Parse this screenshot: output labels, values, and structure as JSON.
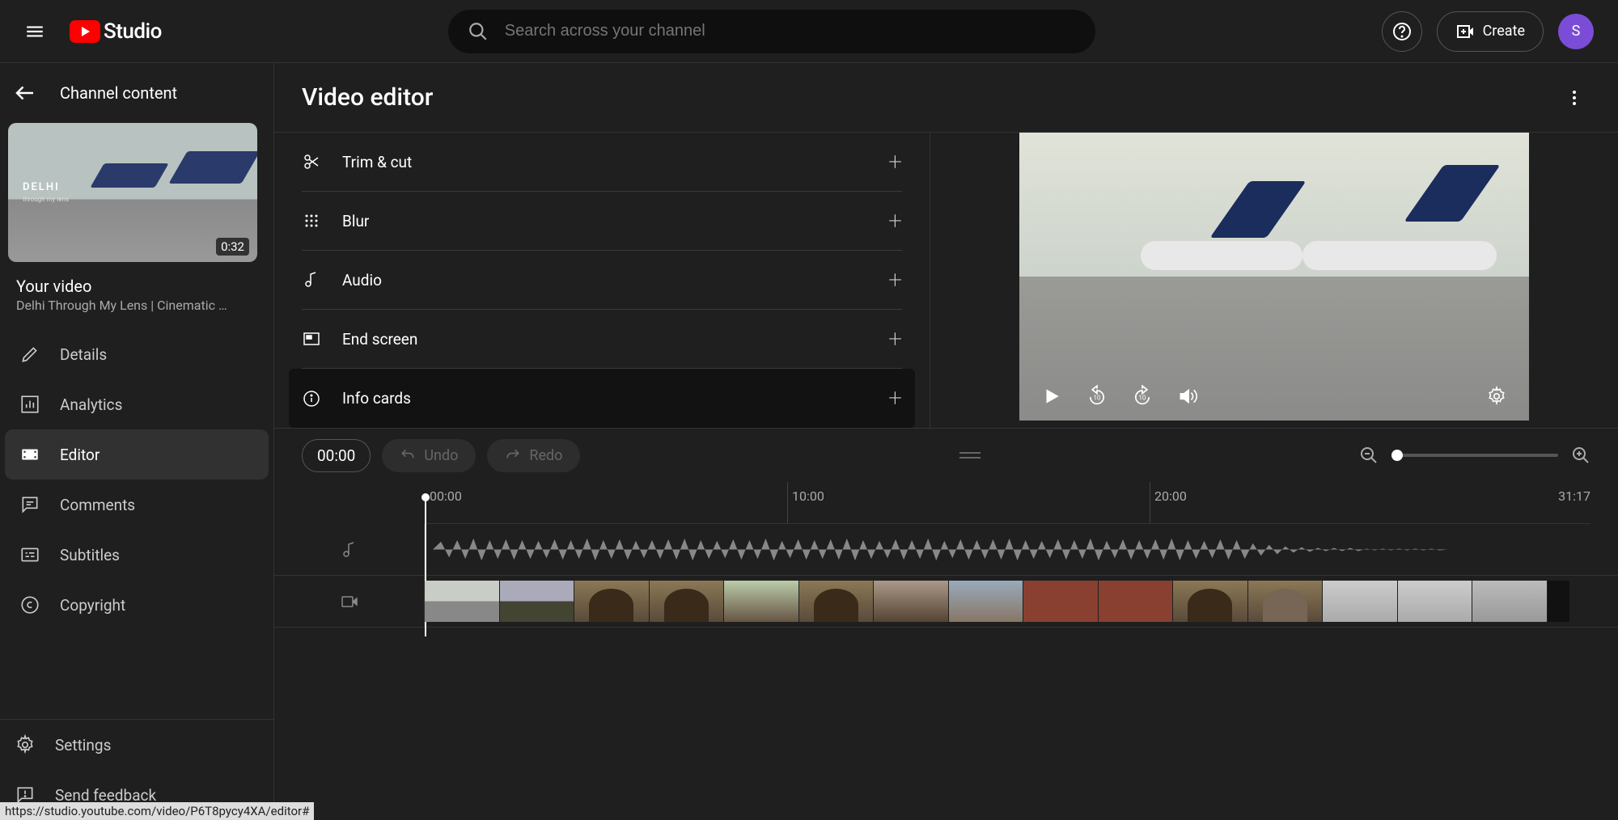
{
  "header": {
    "logo_text": "Studio",
    "search_placeholder": "Search across your channel",
    "create_label": "Create",
    "avatar_letter": "S"
  },
  "sidebar": {
    "back_label": "Channel content",
    "thumb_duration": "0:32",
    "thumb_title": "DELHI",
    "thumb_sub": "through my lens",
    "your_video": "Your video",
    "video_title": "Delhi Through My Lens | Cinematic …",
    "nav": {
      "details": "Details",
      "analytics": "Analytics",
      "editor": "Editor",
      "comments": "Comments",
      "subtitles": "Subtitles",
      "copyright": "Copyright",
      "settings": "Settings",
      "feedback": "Send feedback"
    }
  },
  "main": {
    "title": "Video editor",
    "tools": {
      "trim": "Trim & cut",
      "blur": "Blur",
      "audio": "Audio",
      "endscreen": "End screen",
      "infocards": "Info cards"
    },
    "controls": {
      "timecode": "00:00",
      "undo": "Undo",
      "redo": "Redo"
    },
    "ruler": {
      "t0": "00:00",
      "t1": "10:00",
      "t2": "20:00",
      "tend": "31:17"
    }
  },
  "status_url": "https://studio.youtube.com/video/P6T8pycy4XA/editor#"
}
